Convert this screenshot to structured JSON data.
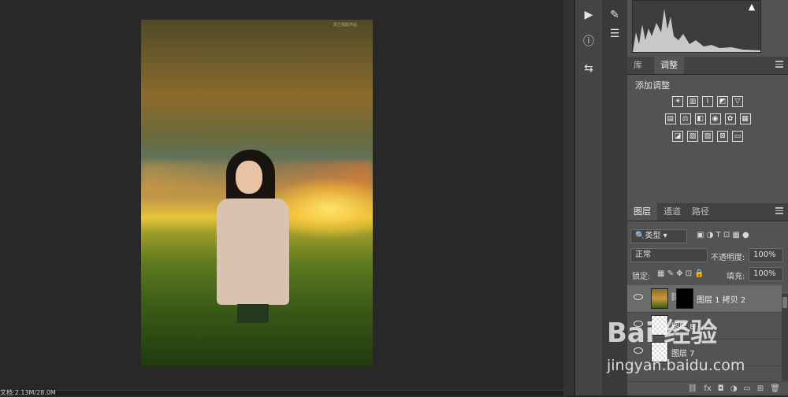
{
  "status_bar": {
    "doc_info": "文档:2.13M/28.0M"
  },
  "document": {
    "watermark": "凯兰摄影作品"
  },
  "adjustments_panel": {
    "tabs": [
      {
        "label": "库"
      },
      {
        "label": "调整"
      }
    ],
    "title": "添加调整",
    "row1": [
      "brightness-icon",
      "levels-icon",
      "curves-icon",
      "exposure-icon",
      "vibrance-icon"
    ],
    "row2": [
      "hsl-icon",
      "color-balance-icon",
      "bw-icon",
      "photo-filter-icon",
      "channel-mixer-icon",
      "color-lookup-icon"
    ],
    "row3": [
      "invert-icon",
      "posterize-icon",
      "threshold-icon",
      "selective-color-icon",
      "gradient-map-icon"
    ]
  },
  "layers_panel": {
    "tabs": [
      {
        "label": "图层"
      },
      {
        "label": "通道"
      },
      {
        "label": "路径"
      }
    ],
    "filter_kind": "类型",
    "blend_mode": "正常",
    "opacity_label": "不透明度:",
    "opacity_value": "100%",
    "lock_label": "锁定:",
    "fill_label": "填充:",
    "fill_value": "100%",
    "layers": [
      {
        "name": "图层 1 拷贝 2",
        "selected": true
      },
      {
        "name": "图层 8",
        "selected": false
      },
      {
        "name": "图层 7",
        "selected": false
      }
    ],
    "footer": [
      "link-icon",
      "fx-icon",
      "mask-icon",
      "adjustment-icon",
      "folder-icon",
      "new-layer-icon",
      "trash-icon"
    ]
  },
  "watermark": {
    "brand": "Bai 经验",
    "url": "jingyan.baidu.com"
  }
}
